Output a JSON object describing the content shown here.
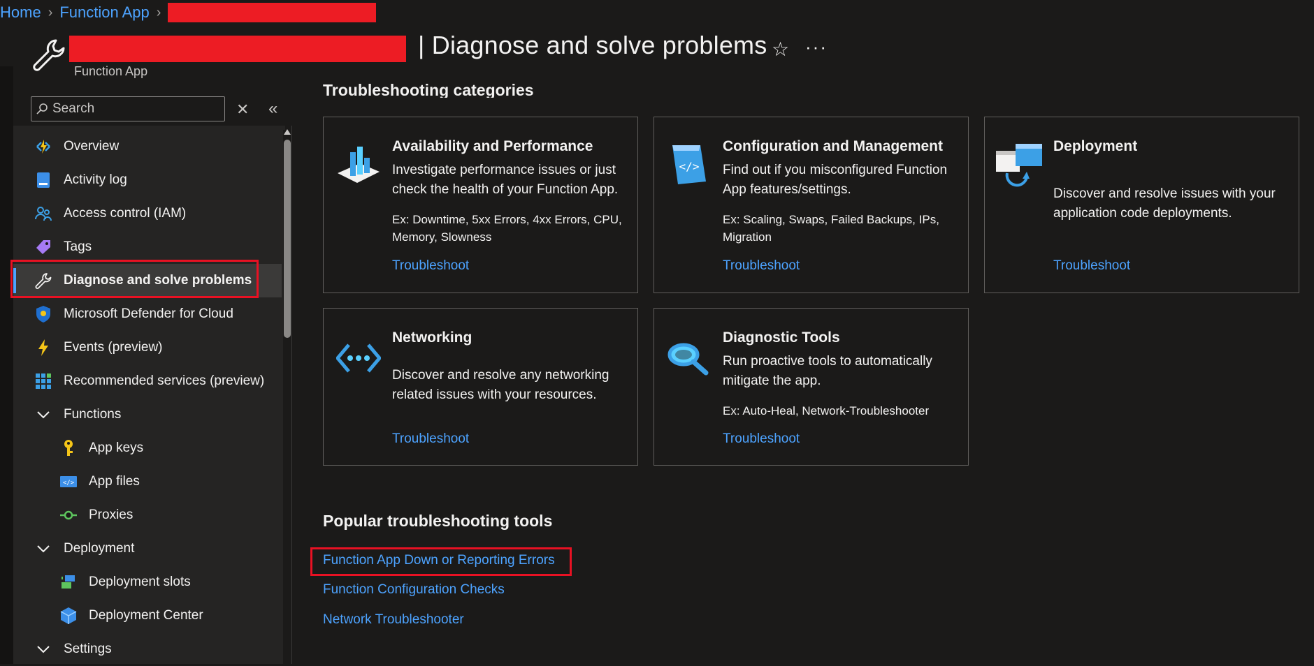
{
  "breadcrumb": {
    "home": "Home",
    "function_app": "Function App"
  },
  "header": {
    "title": "| Diagnose and solve problems",
    "subtitle": "Function App",
    "favorite_icon": "star-icon",
    "more_icon": "more-icon"
  },
  "sidebar": {
    "search_placeholder": "Search",
    "items": [
      {
        "label": "Overview",
        "icon": "function-app-icon"
      },
      {
        "label": "Activity log",
        "icon": "activity-log-icon"
      },
      {
        "label": "Access control (IAM)",
        "icon": "people-icon"
      },
      {
        "label": "Tags",
        "icon": "tag-icon"
      },
      {
        "label": "Diagnose and solve problems",
        "icon": "wrench-icon",
        "active": true
      },
      {
        "label": "Microsoft Defender for Cloud",
        "icon": "shield-icon"
      },
      {
        "label": "Events (preview)",
        "icon": "lightning-icon"
      },
      {
        "label": "Recommended services (preview)",
        "icon": "grid-icon"
      },
      {
        "label": "Functions",
        "icon": "chevron-down-icon"
      },
      {
        "label": "App keys",
        "icon": "key-icon"
      },
      {
        "label": "App files",
        "icon": "code-file-icon"
      },
      {
        "label": "Proxies",
        "icon": "proxy-icon"
      },
      {
        "label": "Deployment",
        "icon": "chevron-down-icon"
      },
      {
        "label": "Deployment slots",
        "icon": "slots-icon"
      },
      {
        "label": "Deployment Center",
        "icon": "cube-icon"
      },
      {
        "label": "Settings",
        "icon": "chevron-down-icon"
      }
    ]
  },
  "main": {
    "categories_heading": "Troubleshooting categories",
    "cards": [
      {
        "title": "Availability and Performance",
        "description": "Investigate performance issues or just check the health of your Function App.",
        "examples": "Ex: Downtime, 5xx Errors, 4xx Errors, CPU, Memory, Slowness",
        "link": "Troubleshoot",
        "icon": "bar-chart-icon"
      },
      {
        "title": "Configuration and Management",
        "description": "Find out if you misconfigured Function App features/settings.",
        "examples": "Ex: Scaling, Swaps, Failed Backups, IPs, Migration",
        "link": "Troubleshoot",
        "icon": "config-code-icon"
      },
      {
        "title": "Deployment",
        "description": "Discover and resolve issues with your application code deployments.",
        "examples": "",
        "link": "Troubleshoot",
        "icon": "deployment-icon"
      },
      {
        "title": "Networking",
        "description": "Discover and resolve any networking related issues with your resources.",
        "examples": "",
        "link": "Troubleshoot",
        "icon": "network-icon"
      },
      {
        "title": "Diagnostic Tools",
        "description": "Run proactive tools to automatically mitigate the app.",
        "examples": "Ex: Auto-Heal, Network-Troubleshooter",
        "link": "Troubleshoot",
        "icon": "magnifier-icon"
      }
    ],
    "popular_heading": "Popular troubleshooting tools",
    "popular_links": [
      "Function App Down or Reporting Errors",
      "Function Configuration Checks",
      "Network Troubleshooter"
    ]
  },
  "colors": {
    "background": "#1b1a19",
    "sidebar": "#252423",
    "link": "#4da3ff",
    "highlight_border": "#e81123",
    "redaction": "#ed1c24"
  }
}
